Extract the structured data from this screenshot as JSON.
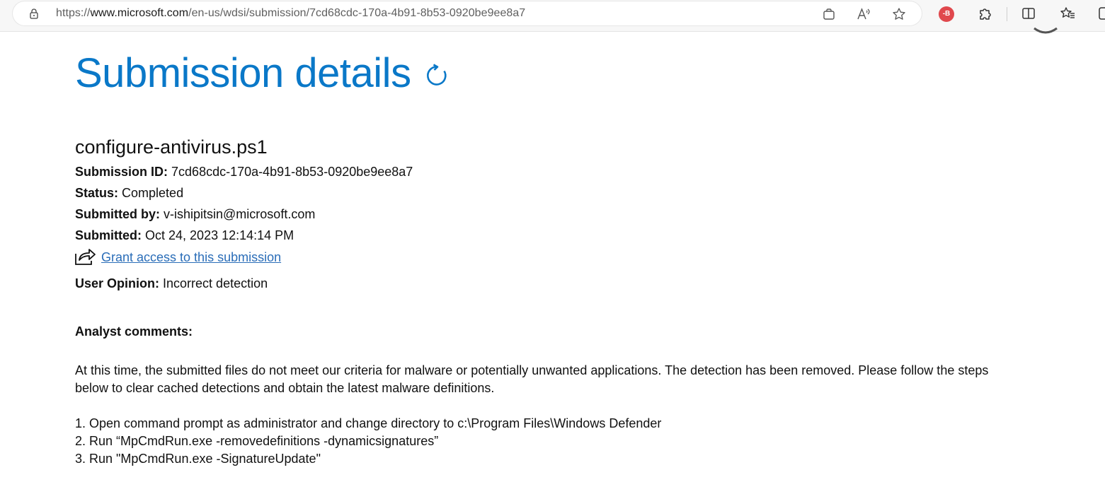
{
  "browser": {
    "url_prefix": "https://",
    "url_host": "www.microsoft.com",
    "url_path": "/en-us/wdsi/submission/7cd68cdc-170a-4b91-8b53-0920be9ee8a7",
    "extension_badge": "-B",
    "icons": [
      "lock-icon",
      "shopping-icon",
      "read-aloud-icon",
      "favorite-star-icon",
      "extension-badge-icon",
      "extensions-puzzle-icon",
      "split-screen-icon",
      "favorites-icon",
      "copilot-icon"
    ]
  },
  "page": {
    "title": "Submission details",
    "file_name": "configure-antivirus.ps1",
    "fields": {
      "submission_id_label": "Submission ID:",
      "submission_id_value": "7cd68cdc-170a-4b91-8b53-0920be9ee8a7",
      "status_label": "Status:",
      "status_value": "Completed",
      "submitted_by_label": "Submitted by:",
      "submitted_by_value": "v-ishipitsin@microsoft.com",
      "submitted_label": "Submitted:",
      "submitted_value": "Oct 24, 2023 12:14:14 PM",
      "user_opinion_label": "User Opinion:",
      "user_opinion_value": "Incorrect detection"
    },
    "grant_access_link": "Grant access to this submission",
    "analyst_heading": "Analyst comments:",
    "analyst_paragraph_line1": "At this time, the submitted files do not meet our criteria for malware or potentially unwanted applications. The detection has been removed. Please follow the steps",
    "analyst_paragraph_line2": "below to clear cached detections and obtain the latest malware definitions.",
    "steps": [
      "1. Open command prompt as administrator and change directory to c:\\Program Files\\Windows Defender",
      "2. Run “MpCmdRun.exe -removedefinitions -dynamicsignatures”",
      "3. Run \"MpCmdRun.exe -SignatureUpdate\""
    ],
    "colors": {
      "title_blue": "#0a78c8",
      "link_blue": "#2a6db8",
      "text": "#111111"
    }
  }
}
